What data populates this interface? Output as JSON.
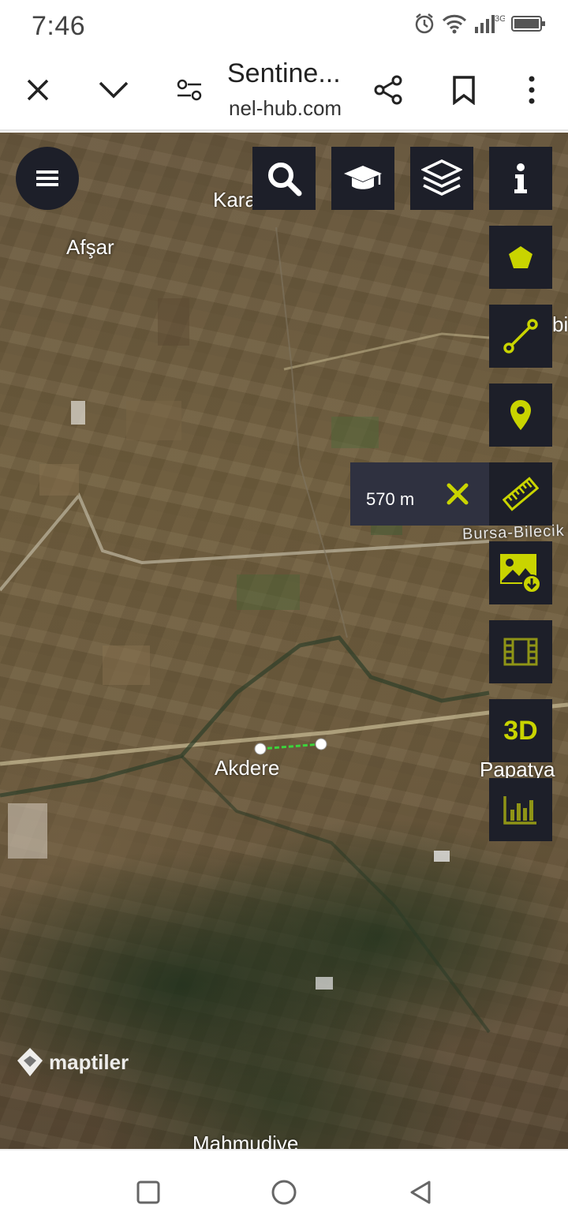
{
  "status_bar": {
    "time": "7:46",
    "network_badge": "3G"
  },
  "browser": {
    "title": "Sentine...",
    "url": "nel-hub.com",
    "icons": [
      "close-icon",
      "chevron-down-icon",
      "site-settings-icon",
      "share-icon",
      "bookmark-icon",
      "more-vert-icon"
    ]
  },
  "map": {
    "labels": {
      "karacabey_partial": "Karacalıdır",
      "afsar": "Afşar",
      "bi_partial": "bi",
      "bursa_bilecik": "Bursa-Bilecik",
      "akdere": "Akdere",
      "papatya": "Papatya",
      "mahmudiye": "Mahmudiye"
    },
    "attribution": "maptiler"
  },
  "toolbar": {
    "top_buttons": [
      "search-icon",
      "education-icon",
      "layers-icon",
      "info-icon"
    ],
    "side_buttons": [
      "polygon-icon",
      "line-measure-icon",
      "pin-icon",
      "ruler-icon",
      "image-download-icon",
      "film-icon",
      "3d",
      "chart-icon"
    ],
    "three_d_label": "3D"
  },
  "measure": {
    "value": "570 m"
  },
  "colors": {
    "accent": "#c9d400",
    "panel_bg": "#1d1f29",
    "measure_line": "#3cd43c"
  },
  "nav": {
    "icons": [
      "recent-apps-icon",
      "home-icon",
      "back-icon"
    ]
  }
}
